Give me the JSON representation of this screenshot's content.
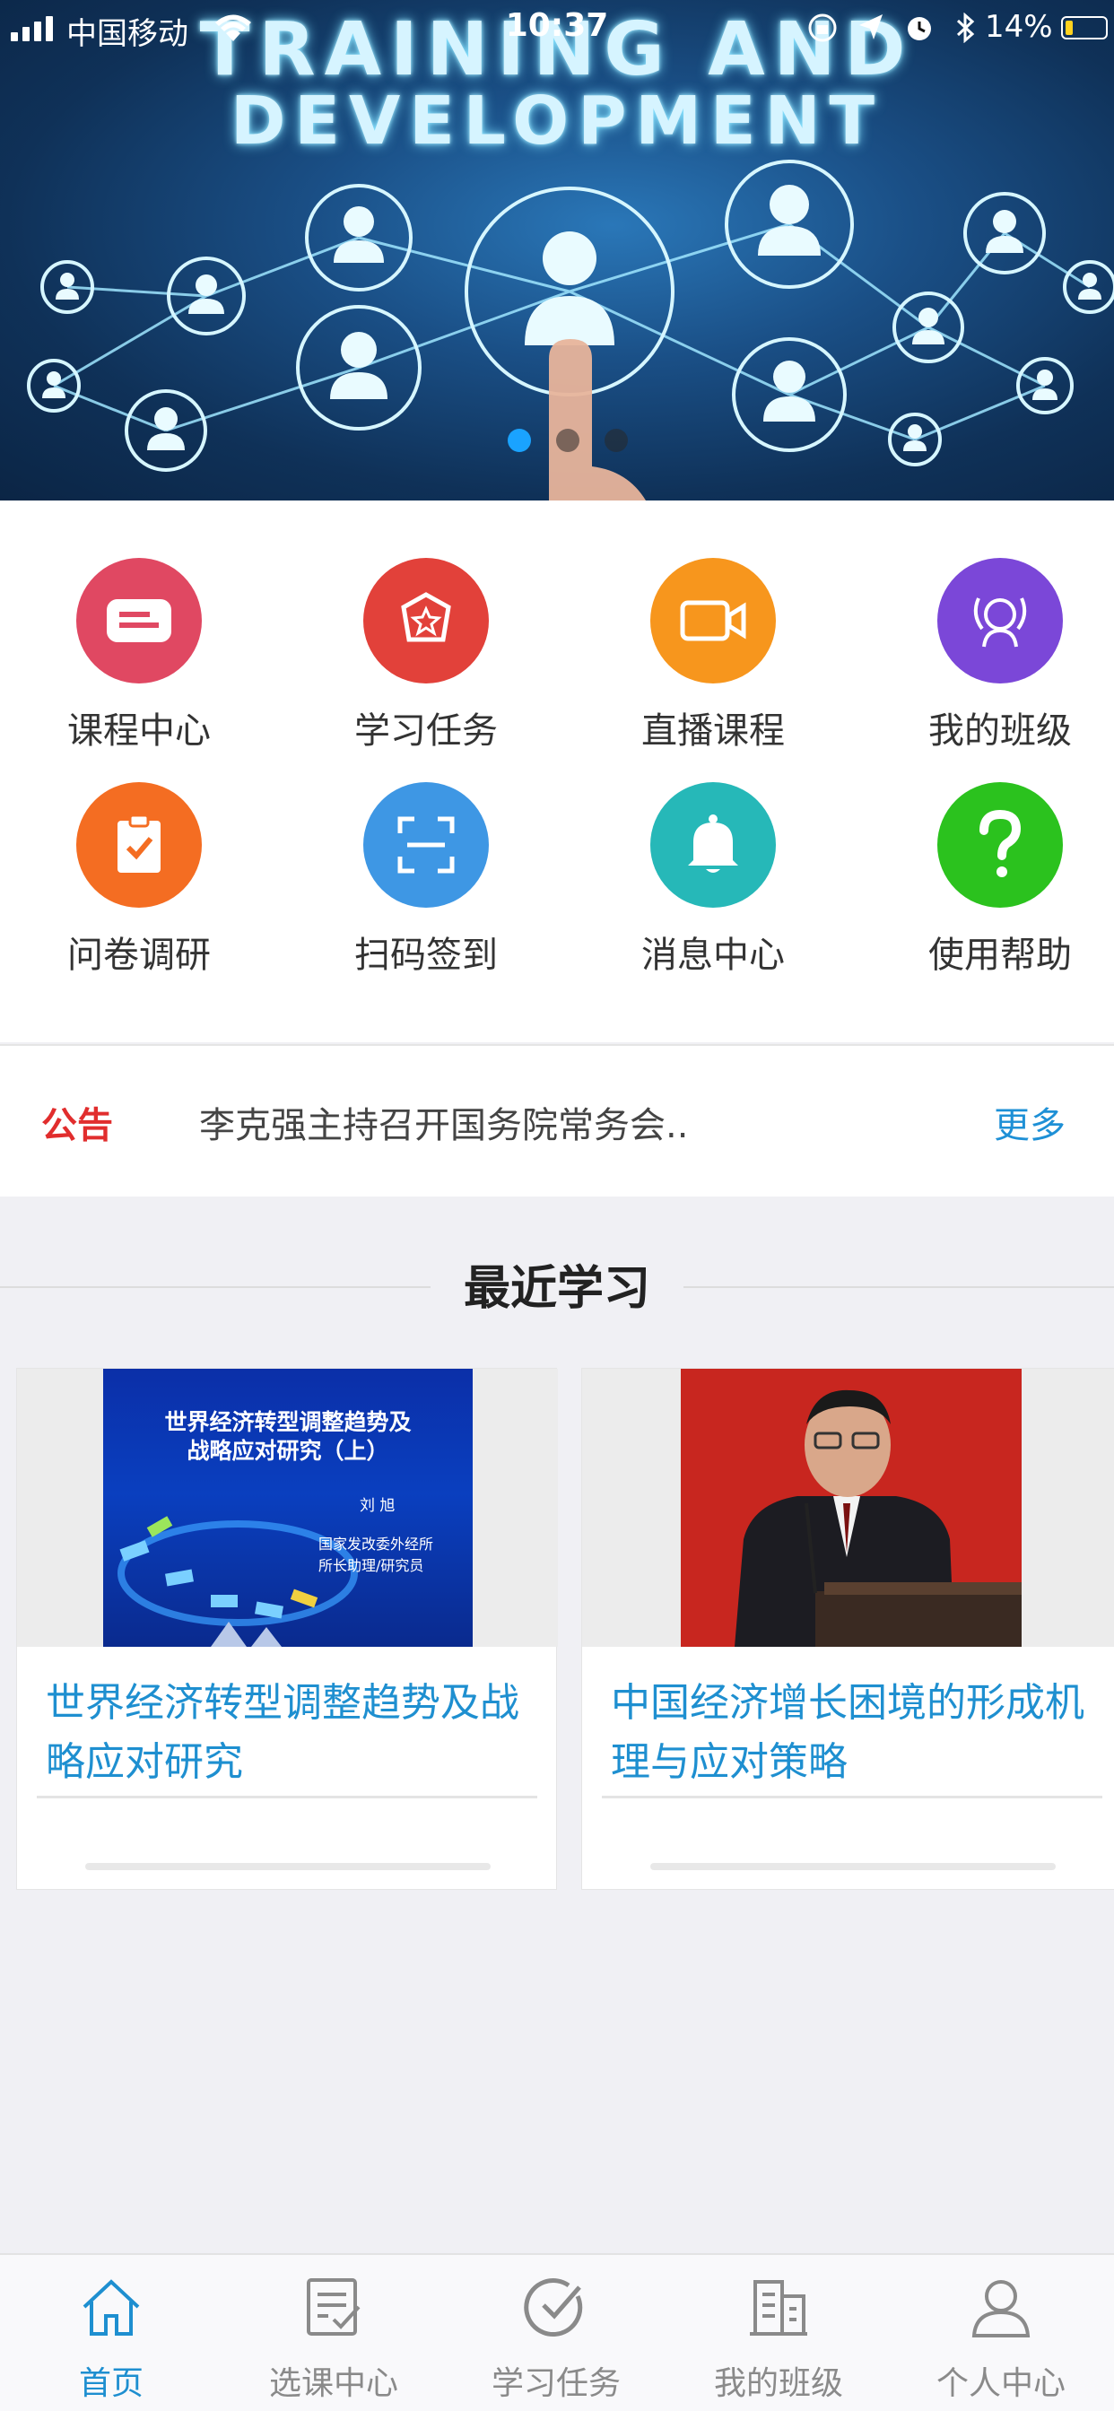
{
  "status_bar": {
    "carrier": "中国移动",
    "time": "10:37",
    "battery": "14%"
  },
  "banner": {
    "line1": "TRAINING AND",
    "line2": "DEVELOPMENT",
    "page_count": 3,
    "active_page": 1
  },
  "grid": [
    {
      "label": "课程中心",
      "icon": "course-center-icon",
      "color": "#e04862"
    },
    {
      "label": "学习任务",
      "icon": "learning-task-icon",
      "color": "#e2413a"
    },
    {
      "label": "直播课程",
      "icon": "live-course-icon",
      "color": "#f7961d"
    },
    {
      "label": "我的班级",
      "icon": "my-class-icon",
      "color": "#7b47d8"
    },
    {
      "label": "问卷调研",
      "icon": "survey-icon",
      "color": "#f46d22"
    },
    {
      "label": "扫码签到",
      "icon": "scan-checkin-icon",
      "color": "#3e97e4"
    },
    {
      "label": "消息中心",
      "icon": "message-center-icon",
      "color": "#26b8b8"
    },
    {
      "label": "使用帮助",
      "icon": "help-icon",
      "color": "#2bc21e"
    }
  ],
  "notice": {
    "tag": "公告",
    "text": "李克强主持召开国务院常务会..",
    "more": "更多"
  },
  "recent": {
    "title": "最近学习",
    "cards": [
      {
        "title": "世界经济转型调整趋势及战略应对研究",
        "slide_title_1": "世界经济转型调整趋势及",
        "slide_title_2": "战略应对研究（上）",
        "slide_author": "刘 旭",
        "slide_org_1": "国家发改委外经所",
        "slide_org_2": "所长助理/研究员"
      },
      {
        "title": "中国经济增长困境的形成机理与应对策略"
      }
    ]
  },
  "tabbar": [
    {
      "label": "首页",
      "icon": "home-icon",
      "active": true
    },
    {
      "label": "选课中心",
      "icon": "course-select-icon",
      "active": false
    },
    {
      "label": "学习任务",
      "icon": "task-check-icon",
      "active": false
    },
    {
      "label": "我的班级",
      "icon": "building-icon",
      "active": false
    },
    {
      "label": "个人中心",
      "icon": "person-icon",
      "active": false
    }
  ],
  "colors": {
    "accent": "#1e8fd0",
    "notice_tag": "#e12d2d",
    "tab_active": "#1e8fd0"
  }
}
